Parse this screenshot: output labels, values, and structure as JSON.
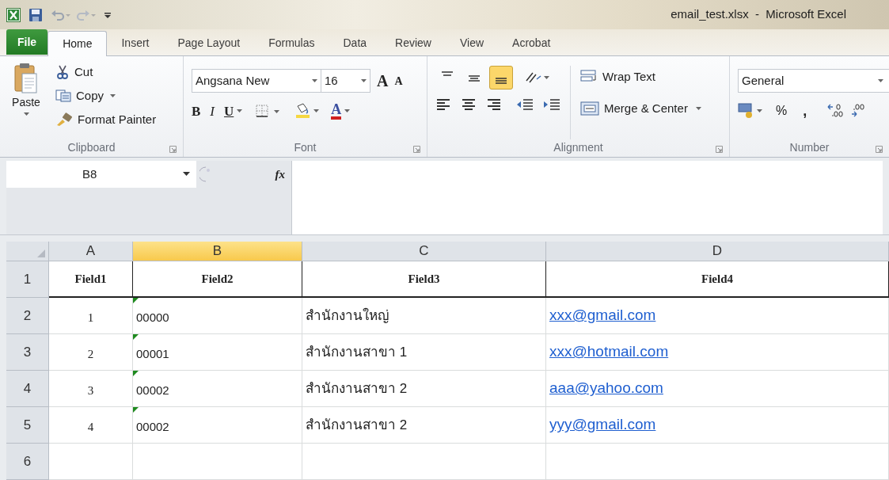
{
  "window": {
    "title": "email_test.xlsx  -  Microsoft Excel"
  },
  "tabs": [
    {
      "label": "File",
      "kind": "file",
      "selected": false
    },
    {
      "label": "Home",
      "kind": "tab",
      "selected": true
    },
    {
      "label": "Insert",
      "kind": "tab",
      "selected": false
    },
    {
      "label": "Page Layout",
      "kind": "tab",
      "selected": false
    },
    {
      "label": "Formulas",
      "kind": "tab",
      "selected": false
    },
    {
      "label": "Data",
      "kind": "tab",
      "selected": false
    },
    {
      "label": "Review",
      "kind": "tab",
      "selected": false
    },
    {
      "label": "View",
      "kind": "tab",
      "selected": false
    },
    {
      "label": "Acrobat",
      "kind": "tab",
      "selected": false
    }
  ],
  "clipboard": {
    "paste": "Paste",
    "cut": "Cut",
    "copy": "Copy",
    "format_painter": "Format Painter",
    "group_label": "Clipboard"
  },
  "font": {
    "font_name": "Angsana New",
    "font_size": "16",
    "bold": "B",
    "italic": "I",
    "underline": "U",
    "grow": "A",
    "shrink": "A",
    "font_color": "A",
    "group_label": "Font"
  },
  "alignment": {
    "vertical_align": [
      {
        "selected": false
      },
      {
        "selected": false
      },
      {
        "selected": true
      }
    ],
    "wrap_text": "Wrap Text",
    "merge_center": "Merge & Center",
    "group_label": "Alignment"
  },
  "number": {
    "format": "General",
    "percent": "%",
    "comma": ",",
    "group_label": "Number"
  },
  "formula_bar": {
    "name_box": "B8",
    "function_label": "fx"
  },
  "sheet": {
    "columns": [
      {
        "label": "A",
        "selected": false
      },
      {
        "label": "B",
        "selected": true
      },
      {
        "label": "C",
        "selected": false
      },
      {
        "label": "D",
        "selected": false
      }
    ],
    "rows": [
      {
        "header": "1",
        "cells": [
          {
            "text": "Field1",
            "kind": "heading"
          },
          {
            "text": "Field2",
            "kind": "heading"
          },
          {
            "text": "Field3",
            "kind": "heading"
          },
          {
            "text": "Field4",
            "kind": "heading"
          }
        ]
      },
      {
        "header": "2",
        "cells": [
          {
            "text": "1",
            "kind": "number"
          },
          {
            "text": "00000",
            "kind": "text_number"
          },
          {
            "text": "สำนักงานใหญ่",
            "kind": "text"
          },
          {
            "text": "xxx@gmail.com",
            "kind": "link"
          }
        ]
      },
      {
        "header": "3",
        "cells": [
          {
            "text": "2",
            "kind": "number"
          },
          {
            "text": "00001",
            "kind": "text_number"
          },
          {
            "text": "สำนักงานสาขา 1",
            "kind": "text"
          },
          {
            "text": "xxx@hotmail.com",
            "kind": "link"
          }
        ]
      },
      {
        "header": "4",
        "cells": [
          {
            "text": "3",
            "kind": "number"
          },
          {
            "text": "00002",
            "kind": "text_number"
          },
          {
            "text": "สำนักงานสาขา 2",
            "kind": "text"
          },
          {
            "text": "aaa@yahoo.com",
            "kind": "link"
          }
        ]
      },
      {
        "header": "5",
        "cells": [
          {
            "text": "4",
            "kind": "number"
          },
          {
            "text": "00002",
            "kind": "text_number"
          },
          {
            "text": "สำนักงานสาขา 2",
            "kind": "text"
          },
          {
            "text": "yyy@gmail.com",
            "kind": "link"
          }
        ]
      },
      {
        "header": "6",
        "cells": []
      }
    ]
  }
}
